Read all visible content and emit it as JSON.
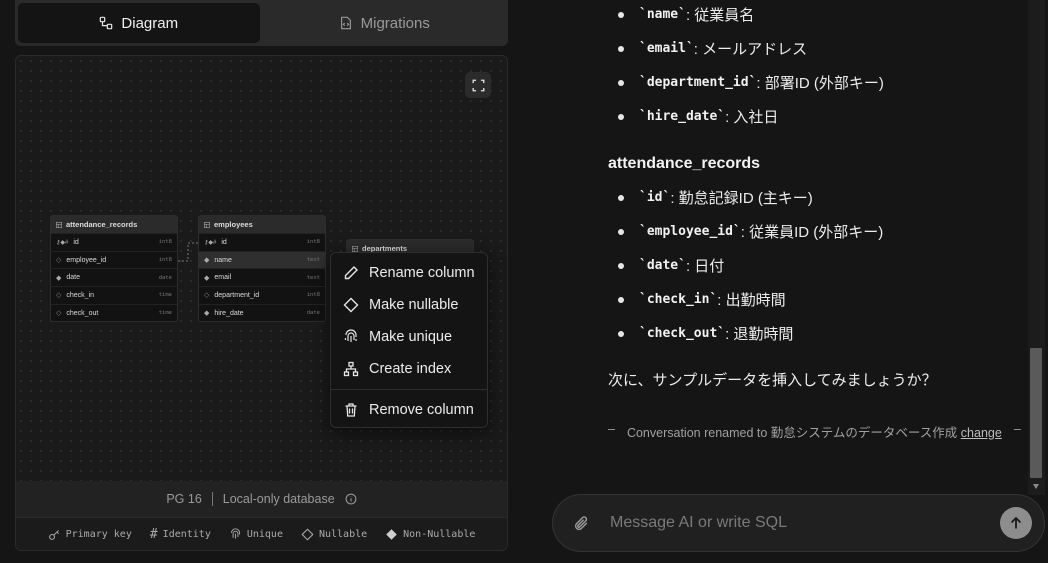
{
  "tabs": {
    "diagram": "Diagram",
    "migrations": "Migrations"
  },
  "diagram": {
    "tables": [
      {
        "name": "attendance_records",
        "columns": [
          {
            "name": "id",
            "type": "int8"
          },
          {
            "name": "employee_id",
            "type": "int8"
          },
          {
            "name": "date",
            "type": "date"
          },
          {
            "name": "check_in",
            "type": "time"
          },
          {
            "name": "check_out",
            "type": "time"
          }
        ]
      },
      {
        "name": "employees",
        "columns": [
          {
            "name": "id",
            "type": "int8"
          },
          {
            "name": "name",
            "type": "text"
          },
          {
            "name": "email",
            "type": "text"
          },
          {
            "name": "department_id",
            "type": "int8"
          },
          {
            "name": "hire_date",
            "type": "date"
          }
        ]
      },
      {
        "name": "departments",
        "columns": []
      }
    ]
  },
  "context_menu": {
    "rename": "Rename column",
    "nullable": "Make nullable",
    "unique": "Make unique",
    "index": "Create index",
    "remove": "Remove column"
  },
  "status": {
    "pg": "PG 16",
    "db": "Local-only database"
  },
  "legend": {
    "primary": "Primary key",
    "identity": "Identity",
    "unique": "Unique",
    "nullable": "Nullable",
    "non_nullable": "Non-Nullable"
  },
  "chat": {
    "emp_fields": [
      {
        "code": "`name`",
        "text": ": 従業員名"
      },
      {
        "code": "`email`",
        "text": ": メールアドレス"
      },
      {
        "code": "`department_id`",
        "text": ": 部署ID (外部キー)"
      },
      {
        "code": "`hire_date`",
        "text": ": 入社日"
      }
    ],
    "att_title": "attendance_records",
    "att_fields": [
      {
        "code": "`id`",
        "text": ": 勤怠記録ID (主キー)"
      },
      {
        "code": "`employee_id`",
        "text": ": 従業員ID (外部キー)"
      },
      {
        "code": "`date`",
        "text": ": 日付"
      },
      {
        "code": "`check_in`",
        "text": ": 出勤時間"
      },
      {
        "code": "`check_out`",
        "text": ": 退勤時間"
      }
    ],
    "next": "次に、サンプルデータを挿入してみましょうか？",
    "system_prefix": "Conversation renamed to",
    "system_name": "勤怠システムのデータベース作成",
    "system_link": "change",
    "dash": "–"
  },
  "composer": {
    "placeholder": "Message AI or write SQL"
  }
}
